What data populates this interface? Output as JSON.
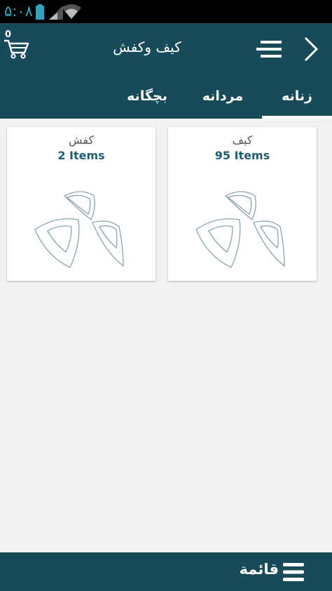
{
  "status_bar": {
    "time": "۵:۰۸",
    "icons": [
      "battery-icon",
      "signal-icon",
      "wifi-icon"
    ]
  },
  "header": {
    "cart_count": "0",
    "title": "کیف وکفش",
    "icons": [
      "cart-icon",
      "menu-icon",
      "chevron-right-icon"
    ]
  },
  "tabs": [
    {
      "label": "زنانه",
      "selected": true
    },
    {
      "label": "مردانه",
      "selected": false
    },
    {
      "label": "بچگانه",
      "selected": false
    }
  ],
  "categories": [
    {
      "name": "کیف",
      "count": "95",
      "unit": "Items",
      "image": "placeholder-logo-icon"
    },
    {
      "name": "کفش",
      "count": "2",
      "unit": "Items",
      "image": "placeholder-logo-icon"
    }
  ],
  "bottom_bar": {
    "label": "قائمة",
    "icon": "list-icon"
  },
  "colors": {
    "primary": "#174b5a",
    "accent_text": "#1e5f73",
    "status_time": "#2aa6c4",
    "background": "#f2f2f2"
  }
}
